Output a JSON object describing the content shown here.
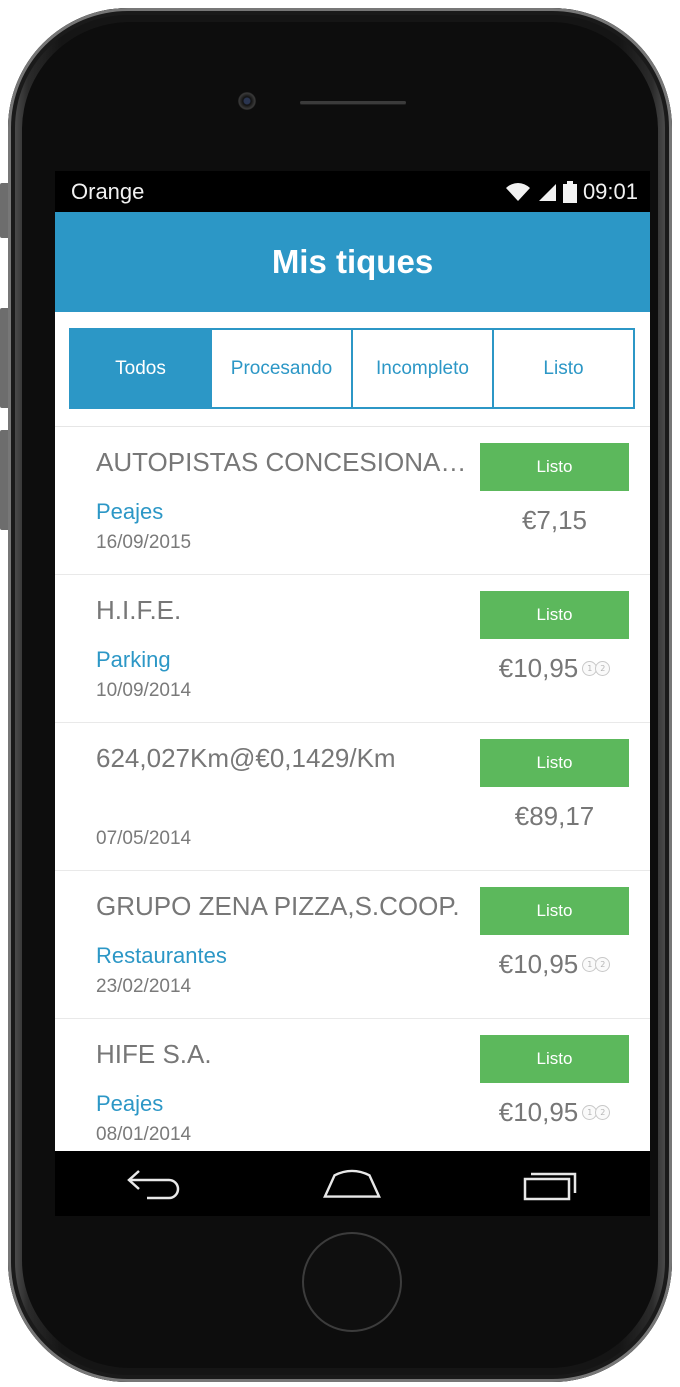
{
  "status_bar": {
    "carrier": "Orange",
    "time": "09:01",
    "icons": [
      "wifi-icon",
      "signal-icon",
      "battery-icon"
    ]
  },
  "app_bar": {
    "title": "Mis tiques"
  },
  "tabs": [
    {
      "label": "Todos",
      "active": true
    },
    {
      "label": "Procesando",
      "active": false
    },
    {
      "label": "Incompleto",
      "active": false
    },
    {
      "label": "Listo",
      "active": false
    }
  ],
  "tickets": [
    {
      "merchant": "AUTOPISTAS CONCESIONARIA ESPAÑOLA",
      "category": "Peajes",
      "date": "16/09/2015",
      "status": "Listo",
      "amount": "€7,15",
      "split_icon": false
    },
    {
      "merchant": "H.I.F.E.",
      "category": "Parking",
      "date": "10/09/2014",
      "status": "Listo",
      "amount": "€10,95",
      "split_icon": true
    },
    {
      "merchant": "624,027Km@€0,1429/Km",
      "category": "",
      "date": "07/05/2014",
      "status": "Listo",
      "amount": "€89,17",
      "split_icon": false
    },
    {
      "merchant": "GRUPO ZENA PIZZA,S.COOP.",
      "category": "Restaurantes",
      "date": "23/02/2014",
      "status": "Listo",
      "amount": "€10,95",
      "split_icon": true
    },
    {
      "merchant": "HIFE S.A.",
      "category": "Peajes",
      "date": "08/01/2014",
      "status": "Listo",
      "amount": "€10,95",
      "split_icon": true
    }
  ],
  "colors": {
    "primary": "#2c97c6",
    "status_ready": "#5cb85c",
    "text_muted": "#777777"
  },
  "nav_buttons": [
    "back-icon",
    "home-icon",
    "recent-apps-icon"
  ]
}
